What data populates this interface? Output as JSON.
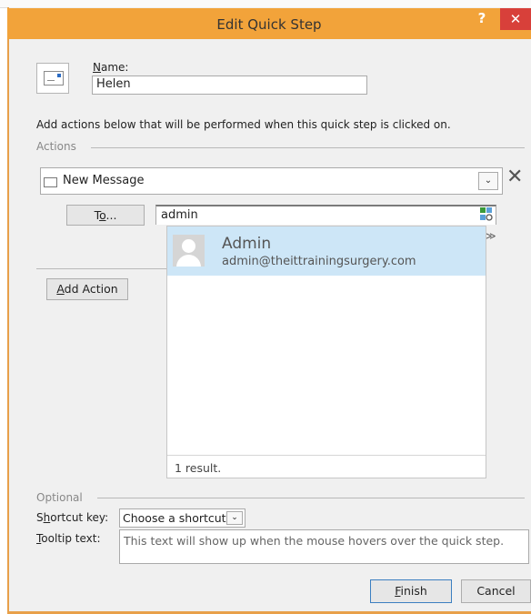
{
  "dialog": {
    "title": "Edit Quick Step",
    "help_label": "?",
    "close_label": "✕"
  },
  "name_field": {
    "label_u": "N",
    "label_rest": "ame:",
    "value": "Helen"
  },
  "instructions": "Add actions below that will be performed when this quick step is clicked on.",
  "actions": {
    "section_label": "Actions",
    "action_value": "New Message",
    "dropdown_glyph": "⌄",
    "delete_glyph": "✕",
    "to_button": {
      "pre": "T",
      "u": "o",
      "post": "..."
    },
    "to_value": "admin",
    "more_glyph": "≫",
    "add_action": {
      "u": "A",
      "rest": "dd Action"
    }
  },
  "autocomplete": {
    "name": "Admin",
    "email": "admin@theittrainingsurgery.com",
    "result_count": "1 result."
  },
  "optional": {
    "section_label": "Optional",
    "shortcut_label": {
      "pre": "S",
      "u": "h",
      "post": "ortcut key:"
    },
    "shortcut_value": "Choose a shortcut",
    "tooltip_label": {
      "u": "T",
      "post": "ooltip text:"
    },
    "tooltip_placeholder": "This text will show up when the mouse hovers over the quick step."
  },
  "footer": {
    "finish": {
      "u": "F",
      "post": "inish"
    },
    "cancel": "Cancel"
  },
  "colors": {
    "titlebar": "#f2a33a",
    "close_button": "#d8403a",
    "suggestion_highlight": "#cde6f7"
  }
}
